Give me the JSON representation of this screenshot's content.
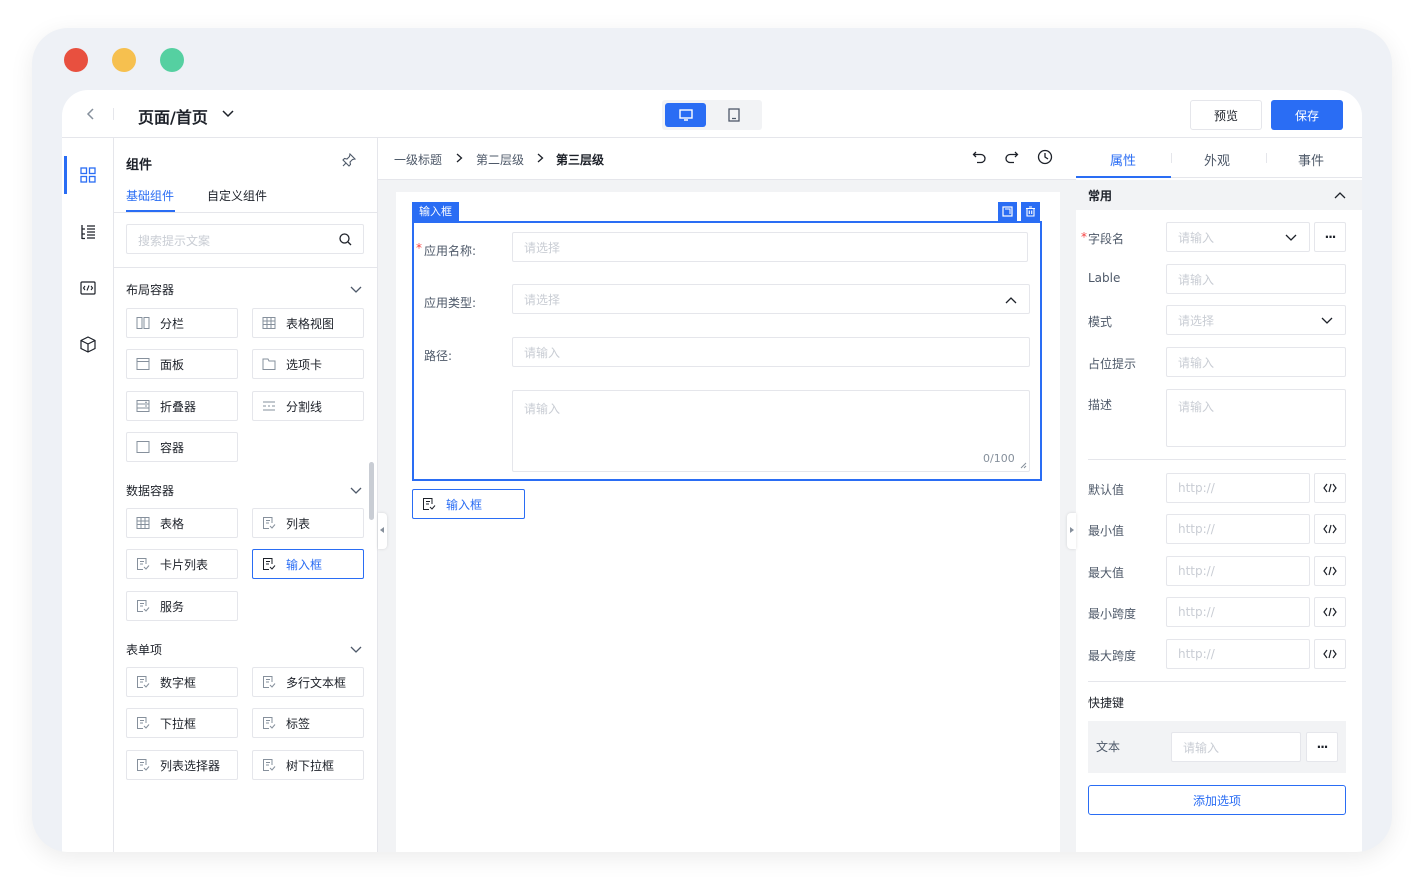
{
  "window": {
    "controls": [
      {
        "name": "close",
        "color": "#e8503f"
      },
      {
        "name": "minimize",
        "color": "#f6c04f"
      },
      {
        "name": "zoom",
        "color": "#55d0a1"
      }
    ]
  },
  "header": {
    "title": "页面/首页",
    "preview_label": "预览",
    "save_label": "保存"
  },
  "components_panel": {
    "title": "组件",
    "tabs": [
      "基础组件",
      "自定义组件"
    ],
    "search_placeholder": "搜索提示文案",
    "sections": [
      {
        "title": "布局容器",
        "items": [
          "分栏",
          "表格视图",
          "面板",
          "选项卡",
          "折叠器",
          "分割线",
          "容器"
        ]
      },
      {
        "title": "数据容器",
        "items": [
          "表格",
          "列表",
          "卡片列表",
          "输入框",
          "服务"
        ]
      },
      {
        "title": "表单项",
        "items": [
          "数字框",
          "多行文本框",
          "下拉框",
          "标签",
          "列表选择器",
          "树下拉框"
        ]
      }
    ]
  },
  "breadcrumb": [
    "一级标题",
    "第二层级",
    "第三层级"
  ],
  "canvas": {
    "selected_tag": "输入框",
    "form": {
      "fields": [
        {
          "label": "应用名称:",
          "required": true,
          "placeholder": "请选择"
        },
        {
          "label": "应用类型:",
          "required": false,
          "placeholder": "请选择"
        },
        {
          "label": "路径:",
          "required": false,
          "placeholder": "请输入"
        }
      ],
      "textarea_placeholder": "请输入",
      "textarea_count": "0/100"
    },
    "dragging_item": "输入框"
  },
  "properties_panel": {
    "tabs": [
      "属性",
      "外观",
      "事件"
    ],
    "active_tab": "属性",
    "section_title": "常用",
    "field_name_label": "字段名",
    "field_name_placeholder": "请输入",
    "label_label": "Lable",
    "label_placeholder": "请输入",
    "mode_label": "模式",
    "mode_placeholder": "请选择",
    "placeholder_label": "占位提示",
    "placeholder_placeholder": "请输入",
    "desc_label": "描述",
    "desc_placeholder": "请输入",
    "url_fields": [
      {
        "label": "默认值",
        "placeholder": "http://"
      },
      {
        "label": "最小值",
        "placeholder": "http://"
      },
      {
        "label": "最大值",
        "placeholder": "http://"
      },
      {
        "label": "最小跨度",
        "placeholder": "http://"
      },
      {
        "label": "最大跨度",
        "placeholder": "http://"
      }
    ],
    "shortcut_title": "快捷键",
    "shortcut_text_label": "文本",
    "shortcut_placeholder": "请输入",
    "add_option_label": "添加选项"
  },
  "colors": {
    "primary": "#2a6df4",
    "required": "#f53f3f"
  }
}
